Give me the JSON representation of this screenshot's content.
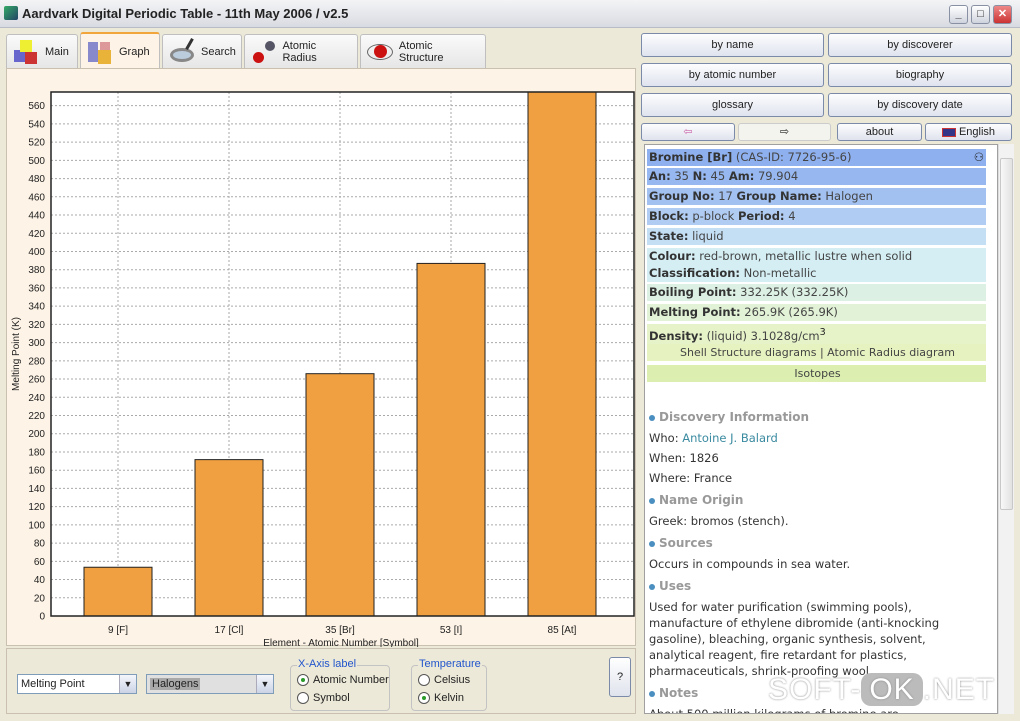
{
  "window": {
    "title": "Aardvark Digital Periodic Table - 11th May 2006 / v2.5",
    "min": "_",
    "max": "□",
    "close": "✕"
  },
  "tabs": [
    {
      "label": "Main",
      "icon": "cubes-icon"
    },
    {
      "label": "Graph",
      "icon": "graph-cubes-icon",
      "active": true
    },
    {
      "label": "Search",
      "icon": "magnifier-icon"
    },
    {
      "label": "Atomic Radius",
      "icon": "atoms-icon"
    },
    {
      "label": "Atomic Structure",
      "icon": "atom-icon"
    }
  ],
  "chart_data": {
    "type": "bar",
    "categories": [
      "9 [F]",
      "17 [Cl]",
      "35 [Br]",
      "53 [I]",
      "85 [At]"
    ],
    "values": [
      53.5,
      171.6,
      265.9,
      386.9,
      575
    ],
    "xlabel": "Element - Atomic Number [Symbol]",
    "ylabel": "Melting Point (K)",
    "ylim": [
      0,
      575
    ],
    "yticks": [
      0,
      20,
      40,
      60,
      80,
      100,
      120,
      140,
      160,
      180,
      200,
      220,
      240,
      260,
      280,
      300,
      320,
      340,
      360,
      380,
      400,
      420,
      440,
      460,
      480,
      500,
      520,
      540,
      560
    ],
    "grid": true,
    "bar_color": "#f0a040"
  },
  "controls": {
    "property": "Melting Point",
    "group": "Halogens",
    "xaxis_legend": "X-Axis label",
    "xaxis_options": [
      "Atomic Number",
      "Symbol"
    ],
    "xaxis_selected": 0,
    "temp_legend": "Temperature",
    "temp_options": [
      "Celsius",
      "Kelvin"
    ],
    "temp_selected": 1,
    "help": "?"
  },
  "nav": {
    "by_name": "by name",
    "by_discoverer": "by discoverer",
    "by_atomic_number": "by atomic number",
    "biography": "biography",
    "glossary": "glossary",
    "by_discovery_date": "by discovery date",
    "back": "⇦",
    "forward": "⇨",
    "about": "about",
    "language": "English"
  },
  "element": {
    "title": "Bromine [Br]",
    "cas": "(CAS-ID: 7726-95-6)",
    "an_l": "An:",
    "an": "35",
    "n_l": "N:",
    "n": "45",
    "am_l": "Am:",
    "am": "79.904",
    "group_l": "Group No:",
    "group": "17",
    "gname_l": "Group Name:",
    "gname": "Halogen",
    "block_l": "Block:",
    "block": "p-block",
    "period_l": "Period:",
    "period": "4",
    "state_l": "State:",
    "state": "liquid",
    "colour_l": "Colour:",
    "colour": "red-brown, metallic lustre when solid",
    "class_l": "Classification:",
    "class": "Non-metallic",
    "bp_l": "Boiling Point:",
    "bp": "332.25K (332.25K)",
    "mp_l": "Melting Point:",
    "mp": "265.9K (265.9K)",
    "density_l": "Density:",
    "density": "(liquid) 3.1028g/cm",
    "density_sup": "3",
    "links": "Shell Structure diagrams | Atomic Radius diagram",
    "isotopes": "Isotopes"
  },
  "sections": {
    "discovery": "Discovery Information",
    "who_l": "Who:",
    "who": "Antoine J. Balard",
    "when": "When:  1826",
    "where": "Where: France",
    "origin": "Name Origin",
    "origin_text": "Greek: bromos (stench).",
    "sources": "Sources",
    "sources_text": "Occurs in compounds in sea water.",
    "uses": "Uses",
    "uses_text": "Used for water purification (swimming pools), manufacture of ethylene dibromide (anti-knocking gasoline), bleaching, organic synthesis, solvent, analytical reagent, fire retardant for plastics, pharmaceuticals, shrink-proofing wool.",
    "notes": "Notes",
    "notes_text": "About 500 million kilograms of bromine are"
  },
  "watermark": {
    "a": "SOFT-",
    "b": "OK",
    ".c": "",
    "c": ".NET"
  }
}
